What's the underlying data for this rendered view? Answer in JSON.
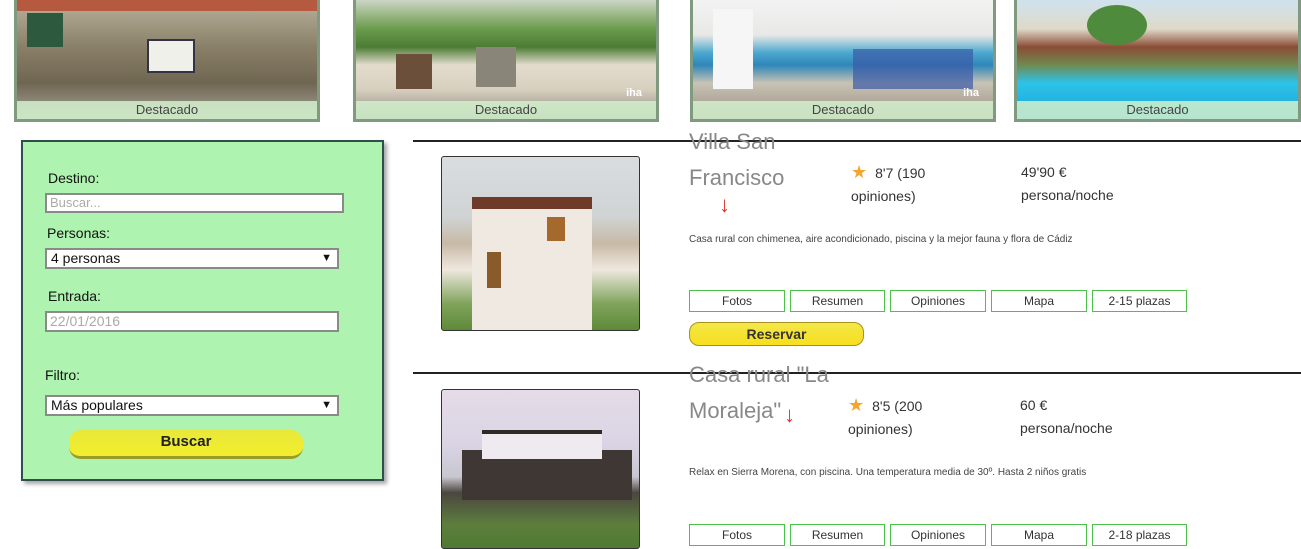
{
  "featured": [
    {
      "label": "Destacado"
    },
    {
      "label": "Destacado",
      "logo": "iha"
    },
    {
      "label": "Destacado",
      "logo": "iha"
    },
    {
      "label": "Destacado"
    }
  ],
  "search": {
    "destino_label": "Destino:",
    "destino_placeholder": "Buscar...",
    "personas_label": "Personas:",
    "personas_value": "4 personas",
    "entrada_label": "Entrada:",
    "entrada_placeholder": "22/01/2016",
    "filtro_label": "Filtro:",
    "filtro_value": "Más populares",
    "submit_label": "Buscar"
  },
  "listings": [
    {
      "title": "Villa San Francisco",
      "rating": "8'7 (190 opiniones)",
      "price": "49'90 € persona/noche",
      "description": "Casa rural con chimenea, aire acondicionado, piscina y la mejor fauna y flora de Cádiz",
      "tabs": [
        "Fotos",
        "Resumen",
        "Opiniones",
        "Mapa",
        "2-15 plazas"
      ],
      "reserve_label": "Reservar"
    },
    {
      "title": "Casa rural \"La Moraleja\"",
      "rating": "8'5 (200 opiniones)",
      "price": "60 € persona/noche",
      "description": "Relax en Sierra Morena, con piscina. Una temperatura media de 30º. Hasta 2 niños gratis",
      "tabs": [
        "Fotos",
        "Resumen",
        "Opiniones",
        "Mapa",
        "2-18 plazas"
      ]
    }
  ],
  "icons": {
    "star": "star-icon",
    "caret": "chevron-down-icon",
    "annotation": "red-arrow-annotation"
  },
  "colors": {
    "panel_bg": "#aef4b0",
    "tab_border": "#4cc14c",
    "button_yellow": "#f3e74a",
    "star": "#f4a52c",
    "annotation_red": "#e3312b"
  }
}
